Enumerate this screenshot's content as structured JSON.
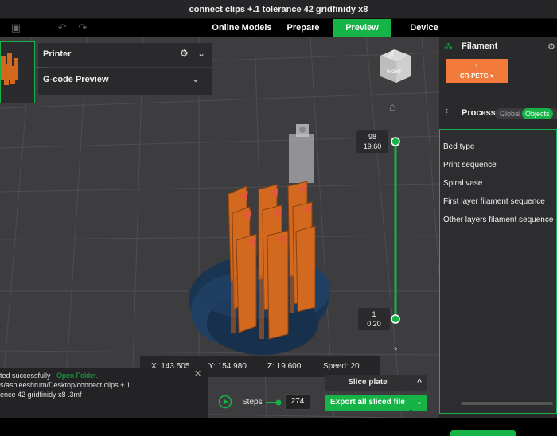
{
  "window": {
    "title": "connect clips +.1 tolerance 42 gridfinidy x8"
  },
  "menubar": {
    "tabs": [
      {
        "label": "Online Models"
      },
      {
        "label": "Prepare"
      },
      {
        "label": "Preview",
        "active": true
      },
      {
        "label": "Device"
      }
    ],
    "icons": [
      "save-icon",
      "undo-icon",
      "redo-icon"
    ]
  },
  "viewport": {
    "panels": {
      "printer": "Printer",
      "gcode": "G-code Preview"
    },
    "navcube": {
      "top": "TOP",
      "right": "RIGHT"
    },
    "layer_slider": {
      "top_layer": "98",
      "top_height": "19.60",
      "bottom_layer": "1",
      "bottom_height": "0.20",
      "help": "?"
    },
    "coords": {
      "x": "X: 143.505",
      "y": "Y: 154.980",
      "z": "Z: 19.600",
      "speed": "Speed: 20"
    },
    "log": {
      "line1_prefix": "ted successfully",
      "line1_link": "Open Folder.",
      "line2": "s/ashleeshrum/Desktop/connect clips +.1",
      "line3": "ence 42 gridfinidy x8 .3mf",
      "close": "✕"
    },
    "steps": {
      "label": "Steps",
      "value": "274"
    },
    "slice_plate": "Slice plate",
    "export": "Export all sliced file"
  },
  "right_panel": {
    "filament_title": "Filament",
    "filament_chip": {
      "index": "1",
      "name": "CR-PETG ▾"
    },
    "process_title": "Process",
    "toggle": {
      "global": "Global",
      "objects": "Objects"
    },
    "object_settings": [
      "Bed type",
      "Print sequence",
      "Spiral vase",
      "First layer filament sequence",
      "Other layers filament sequence"
    ]
  },
  "colors": {
    "accent_green": "#16b346",
    "filament_orange": "#f27a3a",
    "viewport_bg": "#3d3d40",
    "support_blue": "#1d3a5c"
  }
}
